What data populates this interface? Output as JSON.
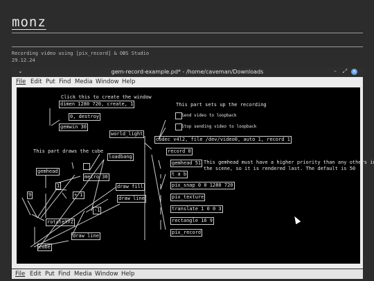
{
  "blog": {
    "title": "monz",
    "caption_line1": "Recording video using [pix_record] & OBS Studio",
    "caption_line2": "29.12.24"
  },
  "window": {
    "title": "gem-record-example.pd* - /home/caveman/Downloads",
    "chevron": "⌄",
    "minimize": "–",
    "maximize": "⤢",
    "close": "×"
  },
  "menu": [
    "File",
    "Edit",
    "Put",
    "Find",
    "Media",
    "Window",
    "Help"
  ],
  "comments": {
    "click_create": "Click this to create the window",
    "setup_recording": "This part sets up the recording",
    "send_video": "Send video to loopback",
    "stop_video": "Stop sending video to loopback",
    "draws_cube": "This part draws the cube",
    "gemhead_note1": "This gemhead must have a higher priority than any others in",
    "gemhead_note2": "the scene, so it is rendered last. The default is 50"
  },
  "objects": {
    "dimen": "dimen 1280 720, create, 1",
    "destroy": "0, destroy",
    "gemwin": "gemwin 30",
    "world_light": "world_light",
    "codec": "codec v4l2, file /dev/video0, auto 1, record 1",
    "record0": "record 0",
    "gemhead51": "gemhead 51",
    "tab": "t a b",
    "pix_snap": "pix_snap 0 0 1280 720",
    "pix_texture": "pix_texture",
    "translate": "translate 1 0 0 3",
    "rectangle": "rectangle 16 9",
    "pix_record": "pix_record",
    "loadbang": "loadbang",
    "gemhead": "gemhead",
    "metro": "metro 30",
    "one": "1",
    "plus1": "+ 1",
    "nine": "9",
    "minus1": "-1",
    "draw_fill": "draw fill",
    "draw_line1": "draw line",
    "rotateXYZ": "rotateXYZ",
    "draw_line2": "draw line",
    "cube": "cube"
  },
  "colors": {
    "page_bg": "#2c2c2c",
    "canvas_bg": "#000000",
    "wire": "#cfcfcf",
    "close_button": "#6aa5e6"
  }
}
